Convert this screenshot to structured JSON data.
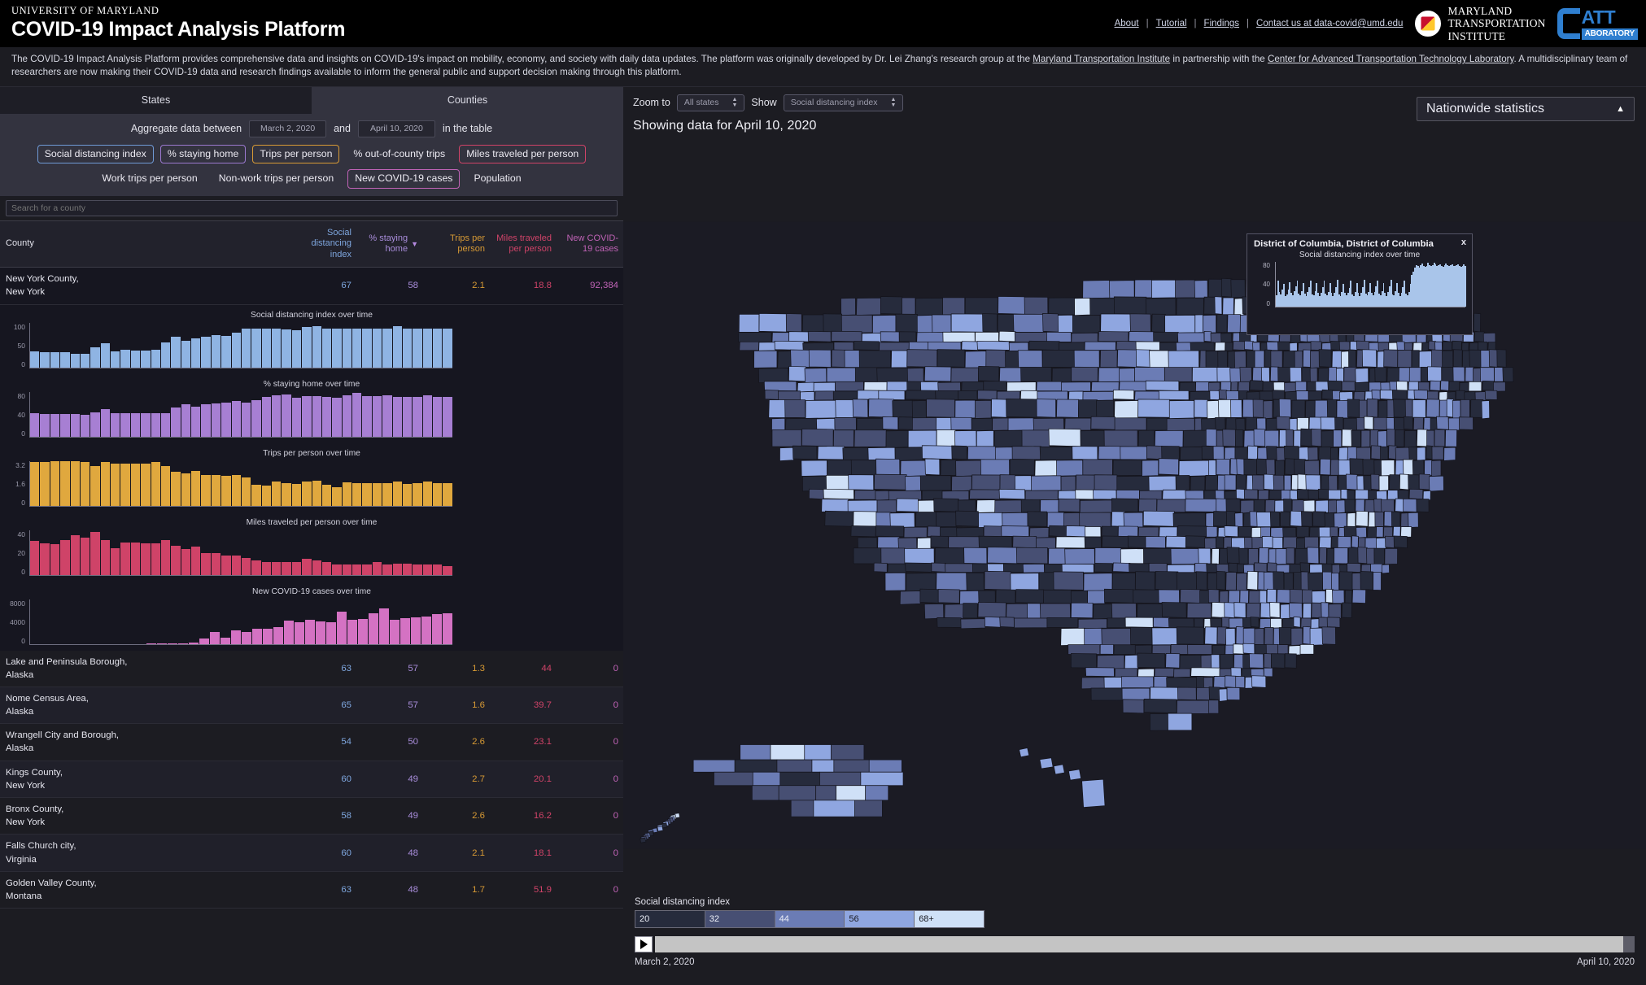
{
  "header": {
    "university": "UNIVERSITY OF MARYLAND",
    "title": "COVID-19 Impact Analysis Platform",
    "links": [
      {
        "label": "About"
      },
      {
        "label": "Tutorial"
      },
      {
        "label": "Findings"
      },
      {
        "label": "Contact us at data-covid@umd.edu"
      }
    ],
    "separator": "|",
    "mti_logo_text": "MARYLAND\nTRANSPORTATION\nINSTITUTE",
    "catt_text": "ATT",
    "catt_sub": "ABORATORY"
  },
  "intro": {
    "part1": "The COVID-19 Impact Analysis Platform provides comprehensive data and insights on COVID-19's impact on mobility, economy, and society with daily data updates. The platform was originally developed by Dr. Lei Zhang's research group at the ",
    "link1": "Maryland Transportation Institute",
    "part2": " in partnership with the ",
    "link2": "Center for Advanced Transportation Technology Laboratory",
    "part3": ". A multidisciplinary team of researchers are now making their COVID-19 data and research findings available to inform the general public and support decision making through this platform."
  },
  "tabs": [
    {
      "label": "States",
      "active": false
    },
    {
      "label": "Counties",
      "active": true
    }
  ],
  "controls": {
    "aggregate_prefix": "Aggregate data between",
    "start_date": "March 2, 2020",
    "and_label": "and",
    "end_date": "April 10, 2020",
    "aggregate_suffix": "in the table",
    "metrics_row1": [
      {
        "label": "Social distancing index",
        "color": "#6f9ad6",
        "selected": true
      },
      {
        "label": "% staying home",
        "color": "#9b79cf",
        "selected": true
      },
      {
        "label": "Trips per person",
        "color": "#d79a35",
        "selected": true
      },
      {
        "label": "% out-of-county trips",
        "color": "",
        "selected": false
      },
      {
        "label": "Miles traveled per person",
        "color": "#cf4368",
        "selected": true
      }
    ],
    "metrics_row2": [
      {
        "label": "Work trips per person",
        "color": "",
        "selected": false
      },
      {
        "label": "Non-work trips per person",
        "color": "",
        "selected": false
      },
      {
        "label": "New COVID-19 cases",
        "color": "#c063b6",
        "selected": true
      },
      {
        "label": "Population",
        "color": "",
        "selected": false
      }
    ]
  },
  "search": {
    "placeholder": "Search for a county",
    "value": ""
  },
  "table": {
    "columns": [
      {
        "label": "County",
        "color": "#e3e3ec",
        "sorted": false
      },
      {
        "label": "Social distancing index",
        "color": "#7ea6de",
        "sorted": false
      },
      {
        "label": "% staying home",
        "color": "#a98ddb",
        "sorted": true,
        "caret": "▼"
      },
      {
        "label": "Trips per person",
        "color": "#d79a35",
        "sorted": false
      },
      {
        "label": "Miles traveled per person",
        "color": "#cf4368",
        "sorted": false
      },
      {
        "label": "New COVID-19 cases",
        "color": "#c063b6",
        "sorted": false
      }
    ],
    "selected_row": {
      "county": "New York County,",
      "state": "New York",
      "sdi": "67",
      "staying_home": "58",
      "trips": "2.1",
      "miles": "18.8",
      "cases": "92,384"
    },
    "rows": [
      {
        "county": "Lake and Peninsula Borough,",
        "state": "Alaska",
        "sdi": "63",
        "staying_home": "57",
        "trips": "1.3",
        "miles": "44",
        "cases": "0"
      },
      {
        "county": "Nome Census Area,",
        "state": "Alaska",
        "sdi": "65",
        "staying_home": "57",
        "trips": "1.6",
        "miles": "39.7",
        "cases": "0"
      },
      {
        "county": "Wrangell City and Borough,",
        "state": "Alaska",
        "sdi": "54",
        "staying_home": "50",
        "trips": "2.6",
        "miles": "23.1",
        "cases": "0"
      },
      {
        "county": "Kings County,",
        "state": "New York",
        "sdi": "60",
        "staying_home": "49",
        "trips": "2.7",
        "miles": "20.1",
        "cases": "0"
      },
      {
        "county": "Bronx County,",
        "state": "New York",
        "sdi": "58",
        "staying_home": "49",
        "trips": "2.6",
        "miles": "16.2",
        "cases": "0"
      },
      {
        "county": "Falls Church city,",
        "state": "Virginia",
        "sdi": "60",
        "staying_home": "48",
        "trips": "2.1",
        "miles": "18.1",
        "cases": "0"
      },
      {
        "county": "Golden Valley County,",
        "state": "Montana",
        "sdi": "63",
        "staying_home": "48",
        "trips": "1.7",
        "miles": "51.9",
        "cases": "0"
      }
    ]
  },
  "map_controls": {
    "zoom_to_label": "Zoom to",
    "zoom_to_value": "All states",
    "show_label": "Show",
    "show_value": "Social distancing index",
    "showing_data": "Showing data for April 10, 2020",
    "nationwide": "Nationwide statistics",
    "nationwide_caret": "▲"
  },
  "tooltip": {
    "title": "District of Columbia, District of Columbia",
    "subtitle": "Social distancing index over time",
    "close": "x",
    "yticks": [
      "80",
      "40",
      "0"
    ]
  },
  "legend": {
    "title": "Social distancing index",
    "cells": [
      {
        "label": "20",
        "color": "#262b3c"
      },
      {
        "label": "32",
        "color": "#474f73"
      },
      {
        "label": "44",
        "color": "#6b7cb5"
      },
      {
        "label": "56",
        "color": "#8fa6e0"
      },
      {
        "label": "68+",
        "color": "#cfe0f7"
      }
    ]
  },
  "timeline": {
    "play_icon": "play-icon",
    "start_date": "March 2, 2020",
    "end_date": "April 10, 2020",
    "position_percent": 100
  },
  "chart_data": [
    {
      "type": "bar",
      "title": "Social distancing index over time",
      "color": "#8fb4e3",
      "ylabel": "",
      "xlabel": "",
      "ylim": [
        0,
        100
      ],
      "yticks": [
        100,
        50,
        0
      ],
      "values": [
        35,
        33,
        34,
        34,
        30,
        30,
        44,
        54,
        35,
        39,
        37,
        38,
        40,
        56,
        69,
        59,
        64,
        68,
        72,
        70,
        78,
        87,
        87,
        86,
        86,
        85,
        83,
        90,
        92,
        87,
        87,
        86,
        86,
        86,
        86,
        86,
        91,
        86,
        86,
        86,
        86,
        87
      ]
    },
    {
      "type": "bar",
      "title": "% staying home over time",
      "color": "#a77fd3",
      "ylabel": "",
      "xlabel": "",
      "ylim": [
        0,
        80
      ],
      "yticks": [
        80,
        40,
        0
      ],
      "values": [
        41,
        40,
        40,
        40,
        40,
        38,
        43,
        49,
        41,
        41,
        41,
        41,
        42,
        42,
        51,
        58,
        53,
        57,
        59,
        60,
        63,
        60,
        65,
        71,
        74,
        75,
        69,
        72,
        72,
        71,
        69,
        74,
        78,
        72,
        72,
        73,
        70,
        70,
        71,
        74,
        71,
        70
      ]
    },
    {
      "type": "bar",
      "title": "Trips per person over time",
      "color": "#e0a83e",
      "ylabel": "",
      "xlabel": "",
      "ylim": [
        0,
        3.2
      ],
      "yticks": [
        3.2,
        1.6,
        0
      ],
      "values": [
        3.1,
        3.1,
        3.15,
        3.2,
        3.2,
        3.1,
        2.8,
        3.1,
        3.0,
        3.0,
        3.0,
        3.0,
        3.1,
        2.8,
        2.4,
        2.3,
        2.45,
        2.2,
        2.2,
        2.1,
        2.2,
        2.0,
        1.5,
        1.4,
        1.7,
        1.6,
        1.55,
        1.7,
        1.8,
        1.5,
        1.3,
        1.65,
        1.6,
        1.6,
        1.6,
        1.6,
        1.7,
        1.55,
        1.6,
        1.7,
        1.6,
        1.6
      ]
    },
    {
      "type": "bar",
      "title": "Miles traveled per person over time",
      "color": "#cf4368",
      "ylabel": "",
      "xlabel": "",
      "ylim": [
        0,
        40
      ],
      "yticks": [
        40,
        20,
        0
      ],
      "values": [
        30,
        28,
        27,
        31,
        35,
        33,
        38,
        31,
        24,
        29,
        29,
        28,
        28,
        31,
        26,
        23,
        25,
        19,
        19,
        17,
        17,
        15,
        13,
        11,
        11,
        11,
        11,
        14,
        13,
        11,
        9,
        9,
        9,
        9,
        11,
        9,
        10,
        10,
        9,
        9,
        9,
        8
      ]
    },
    {
      "type": "bar",
      "title": "New COVID-19 cases over time",
      "color": "#d472c3",
      "ylabel": "",
      "xlabel": "",
      "ylim": [
        0,
        8000
      ],
      "yticks": [
        8000,
        4000,
        0
      ],
      "values": [
        0,
        0,
        0,
        0,
        0,
        0,
        0,
        0,
        0,
        0,
        0,
        20,
        40,
        80,
        120,
        180,
        900,
        2050,
        1050,
        2400,
        2100,
        2700,
        2650,
        2950,
        4100,
        3850,
        4250,
        4050,
        3800,
        5750,
        4250,
        4400,
        5450,
        6350,
        4250,
        4650,
        4750,
        4900,
        5300,
        5400
      ]
    },
    {
      "type": "area",
      "title": "Social distancing index over time",
      "location": "District of Columbia, District of Columbia",
      "color": "#a9c5ea",
      "ylim": [
        0,
        80
      ],
      "yticks": [
        80,
        40,
        0
      ],
      "values": [
        20,
        46,
        26,
        22,
        30,
        40,
        19,
        22,
        30,
        44,
        24,
        20,
        27,
        36,
        47,
        23,
        20,
        27,
        42,
        23,
        19,
        26,
        35,
        46,
        22,
        20,
        27,
        42,
        24,
        19,
        25,
        35,
        46,
        23,
        20,
        26,
        42,
        24,
        19,
        25,
        35,
        48,
        22,
        19,
        26,
        41,
        24,
        20,
        25,
        34,
        46,
        22,
        19,
        26,
        42,
        24,
        19,
        25,
        35,
        48,
        23,
        20,
        26,
        42,
        24,
        20,
        26,
        36,
        47,
        23,
        20,
        27,
        42,
        24,
        19,
        26,
        36,
        48,
        22,
        20,
        27,
        42,
        24,
        19,
        25,
        35,
        47,
        23,
        20,
        26,
        41,
        56,
        62,
        70,
        74,
        72,
        70,
        74,
        77,
        72,
        71,
        73,
        78,
        74,
        72,
        74,
        79,
        75,
        72,
        74,
        76,
        73,
        71,
        74,
        77,
        74,
        72,
        74,
        76,
        73,
        72,
        74,
        76,
        73,
        71,
        73,
        75,
        72
      ]
    }
  ]
}
